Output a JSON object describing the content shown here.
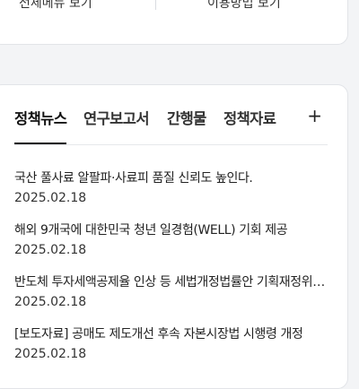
{
  "top_links": {
    "left": "전체메뉴 보기",
    "right": "이용방법 보기"
  },
  "tabs": [
    {
      "label": "정책뉴스",
      "active": true
    },
    {
      "label": "연구보고서",
      "active": false
    },
    {
      "label": "간행물",
      "active": false
    },
    {
      "label": "정책자료",
      "active": false
    }
  ],
  "more_label": "+",
  "news": [
    {
      "title": "국산 풀사료 알팔파·사료피 품질 신뢰도 높인다.",
      "date": "2025.02.18"
    },
    {
      "title": "해외 9개국에 대한민국 청년 일경험(WELL) 기회 제공",
      "date": "2025.02.18"
    },
    {
      "title": "반도체 투자세액공제율 인상 등 세법개정법률안 기획재정위원회 통과",
      "date": "2025.02.18"
    },
    {
      "title": "[보도자료] 공매도 제도개선 후속 자본시장법 시행령 개정",
      "date": "2025.02.18"
    }
  ]
}
